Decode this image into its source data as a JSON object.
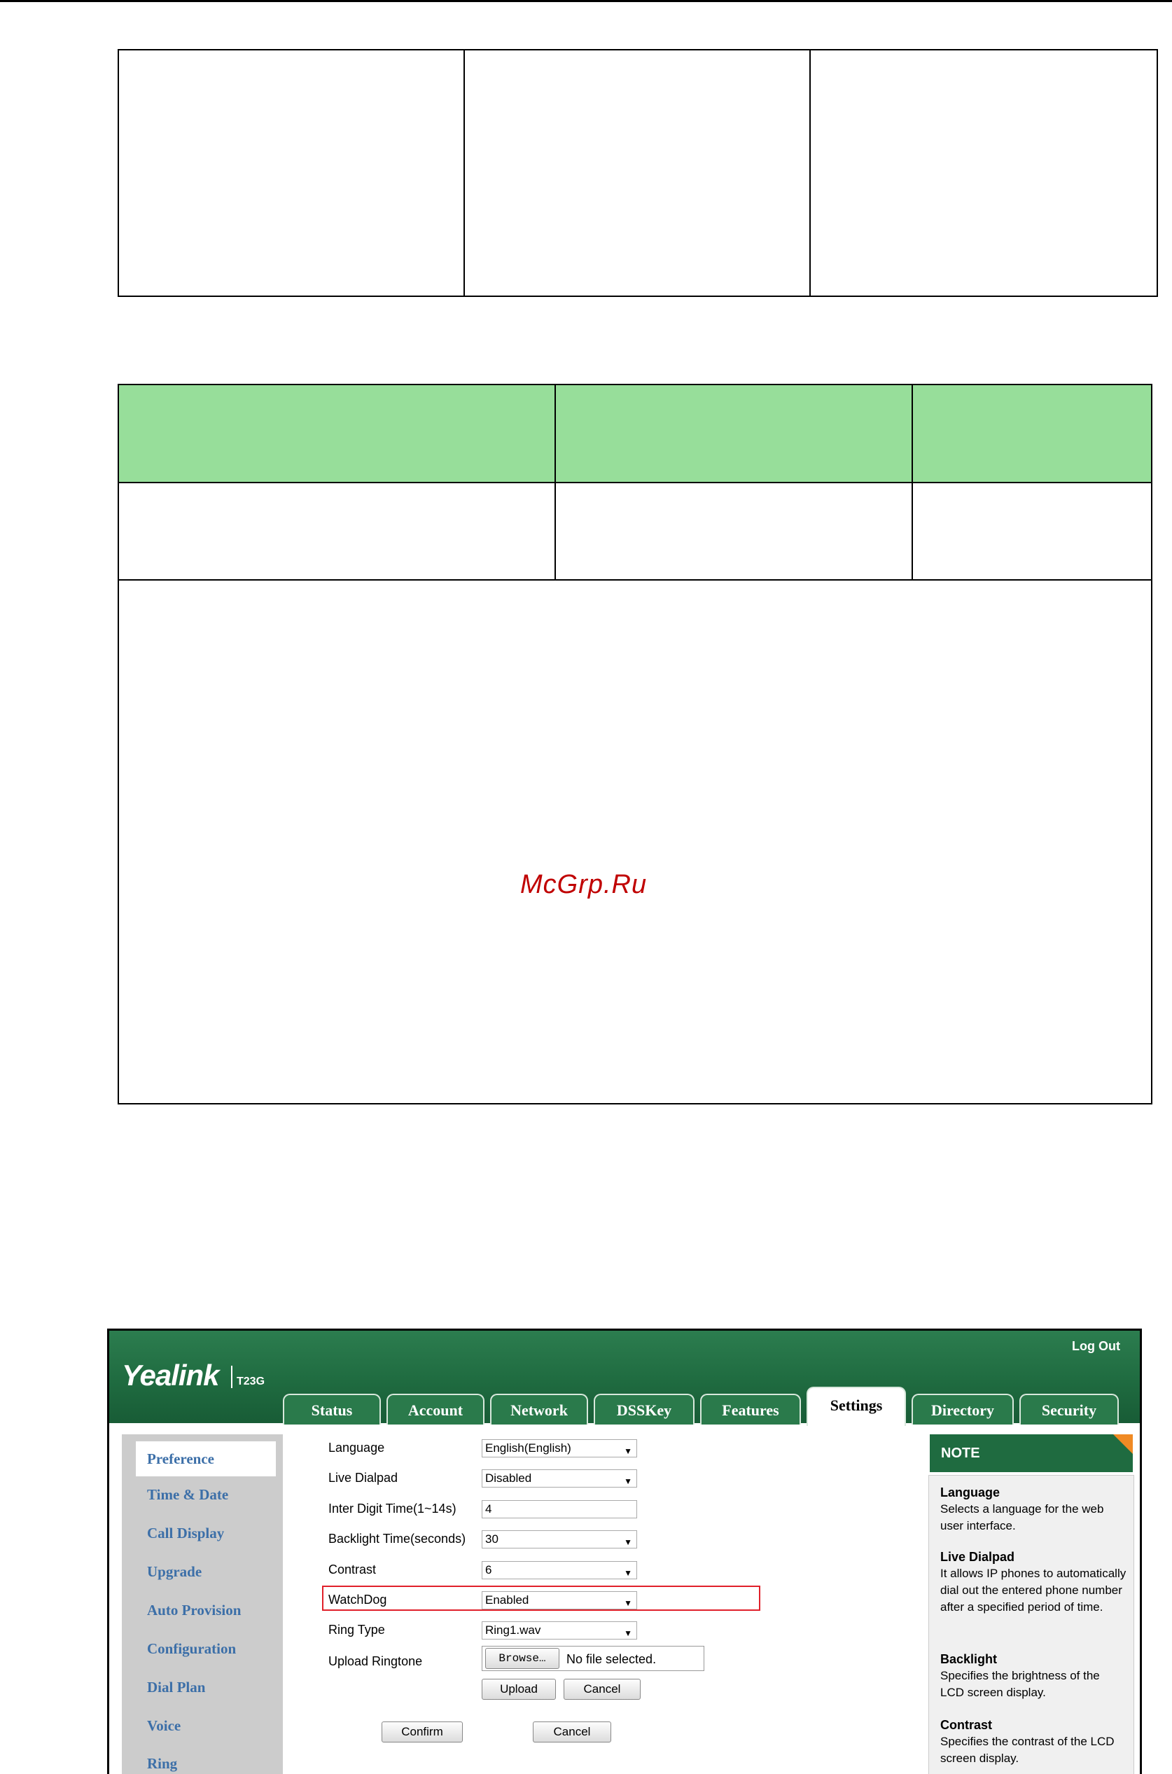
{
  "watermark": "McGrp.Ru",
  "screenshot": {
    "logo": "Yealink",
    "model": "T23G",
    "logout": "Log Out",
    "tabs": [
      {
        "label": "Status"
      },
      {
        "label": "Account"
      },
      {
        "label": "Network"
      },
      {
        "label": "DSSKey"
      },
      {
        "label": "Features"
      },
      {
        "label": "Settings",
        "active": true
      },
      {
        "label": "Directory"
      },
      {
        "label": "Security"
      }
    ],
    "sidebar": [
      {
        "label": "Preference",
        "active": true
      },
      {
        "label": "Time & Date"
      },
      {
        "label": "Call Display"
      },
      {
        "label": "Upgrade"
      },
      {
        "label": "Auto Provision"
      },
      {
        "label": "Configuration"
      },
      {
        "label": "Dial Plan"
      },
      {
        "label": "Voice"
      },
      {
        "label": "Ring"
      }
    ],
    "form": {
      "language": {
        "label": "Language",
        "value": "English(English)"
      },
      "live_dialpad": {
        "label": "Live Dialpad",
        "value": "Disabled"
      },
      "inter_digit": {
        "label": "Inter Digit Time(1~14s)",
        "value": "4"
      },
      "backlight": {
        "label": "Backlight Time(seconds)",
        "value": "30"
      },
      "contrast": {
        "label": "Contrast",
        "value": "6"
      },
      "watchdog": {
        "label": "WatchDog",
        "value": "Enabled"
      },
      "ring_type": {
        "label": "Ring Type",
        "value": "Ring1.wav"
      },
      "upload_ringtone": {
        "label": "Upload Ringtone",
        "browse": "Browse…",
        "file_status": "No file selected."
      },
      "upload_button": "Upload",
      "cancel_small": "Cancel",
      "confirm_button": "Confirm",
      "cancel_button": "Cancel"
    },
    "note": {
      "heading": "NOTE",
      "items": [
        {
          "title": "Language",
          "text": "Selects a language for the web user interface."
        },
        {
          "title": "Live Dialpad",
          "text": "It allows IP phones to automatically dial out the entered phone number after a specified period of time."
        },
        {
          "title": "Backlight",
          "text": "Specifies the brightness of the LCD screen display."
        },
        {
          "title": "Contrast",
          "text": "Specifies the contrast of the LCD screen display."
        }
      ]
    },
    "colors": {
      "header_green": "#1f6b40",
      "link_blue": "#3c6fa8",
      "highlight_red": "#e0202a",
      "note_orange": "#f08a24"
    }
  },
  "colors": {
    "table_header_green": "#97de9a",
    "watermark_red": "#c00000"
  }
}
